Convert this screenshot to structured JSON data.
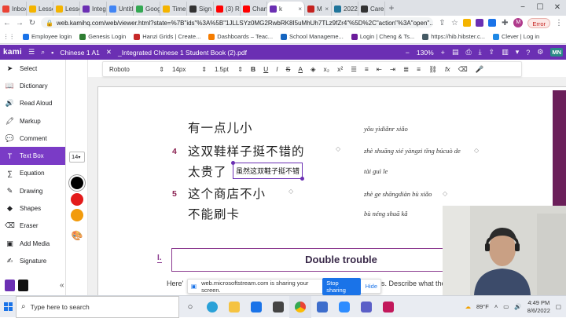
{
  "browser": {
    "tabs": [
      {
        "label": "Inbox",
        "color": "#ea4335"
      },
      {
        "label": "Lessons",
        "color": "#f4b400"
      },
      {
        "label": "Lessons",
        "color": "#f4b400"
      },
      {
        "label": "Integ",
        "color": "#6b2fb3"
      },
      {
        "label": "Untitled",
        "color": "#4285f4"
      },
      {
        "label": "Goog",
        "color": "#34a853"
      },
      {
        "label": "Time",
        "color": "#f4b400"
      },
      {
        "label": "Sign",
        "color": "#333333"
      },
      {
        "label": "(3) Re",
        "color": "#ff0000"
      },
      {
        "label": "Chan",
        "color": "#ff0000"
      },
      {
        "label": "k",
        "color": "#6b2fb3",
        "active": true
      },
      {
        "label": "M",
        "color": "#c5221f"
      },
      {
        "label": "2022",
        "color": "#21759b"
      },
      {
        "label": "Care",
        "color": "#333333"
      }
    ],
    "new_tab": "+",
    "url": "web.kamihq.com/web/viewer.html?state=%7B\"ids\"%3A%5B\"1JLLSYz0MG2RwbRK8I5uMhUh7TLz9fZr4\"%5D%2C\"action\"%3A\"open\"...",
    "error_label": "Error",
    "avatar_initial": "M"
  },
  "bookmarks": [
    {
      "label": "Employee login",
      "color": "#1a73e8"
    },
    {
      "label": "Genesis Login",
      "color": "#2e7d32"
    },
    {
      "label": "Hanzi Grids | Create...",
      "color": "#c62828"
    },
    {
      "label": "Dashboards – Teac...",
      "color": "#f57c00"
    },
    {
      "label": "School Manageme...",
      "color": "#1565c0"
    },
    {
      "label": "Login | Cheng & Ts...",
      "color": "#6a1b9a"
    },
    {
      "label": "https://hib.hibster.c...",
      "color": "#455a64"
    },
    {
      "label": "Clever | Log in",
      "color": "#1e88e5"
    }
  ],
  "kami": {
    "logo": "kami",
    "doc_tab": "Chinese 1 A1",
    "filename": "_Integrated Chinese 1 Student Book (2).pdf",
    "zoom": "130%",
    "user_badge": "MN"
  },
  "sidebar": {
    "items": [
      {
        "label": "Select",
        "icon": "pointer-icon"
      },
      {
        "label": "Dictionary",
        "icon": "book-icon"
      },
      {
        "label": "Read Aloud",
        "icon": "speaker-icon"
      },
      {
        "label": "Markup",
        "icon": "highlighter-icon"
      },
      {
        "label": "Comment",
        "icon": "comment-icon"
      },
      {
        "label": "Text Box",
        "icon": "textbox-icon",
        "active": true
      },
      {
        "label": "Equation",
        "icon": "equation-icon"
      },
      {
        "label": "Drawing",
        "icon": "pen-icon"
      },
      {
        "label": "Shapes",
        "icon": "shapes-icon"
      },
      {
        "label": "Eraser",
        "icon": "eraser-icon"
      },
      {
        "label": "Add Media",
        "icon": "media-icon"
      },
      {
        "label": "Signature",
        "icon": "signature-icon"
      }
    ],
    "collapse": "«"
  },
  "tool_options": {
    "font_size": "14",
    "colors": [
      "#000000",
      "#e31b1b",
      "#f29b0c"
    ]
  },
  "format_bar": {
    "font": "Roboto",
    "size": "14px",
    "line": "1.5pt"
  },
  "document": {
    "lines": [
      {
        "cn": "有一点儿小",
        "py": "yǒu yìdiǎnr xiǎo"
      },
      {
        "cn": "这双鞋样子挺不错的",
        "py": "zhè shuāng xié yàngzi tǐng búcuò de"
      },
      {
        "cn": "太贵了",
        "py": "tài guì le"
      },
      {
        "cn": "这个商店不小",
        "py": "zhè ge shāngdiàn bù xiǎo"
      },
      {
        "cn": "不能刷卡",
        "py": "bù néng shuā kǎ"
      }
    ],
    "num_4": "4",
    "num_5": "5",
    "textbox_text": "虽然这双鞋子挺不错",
    "section_label": "I.",
    "section_title": "Double trouble",
    "bottom_left": "Here'",
    "bottom_right": "s. Describe what the"
  },
  "share_banner": {
    "message": "web.microsoftstream.com is sharing your screen.",
    "stop": "Stop sharing",
    "hide": "Hide"
  },
  "taskbar": {
    "search_placeholder": "Type here to search",
    "weather": "89°F",
    "time": "4:49 PM",
    "date": "8/6/2022"
  }
}
